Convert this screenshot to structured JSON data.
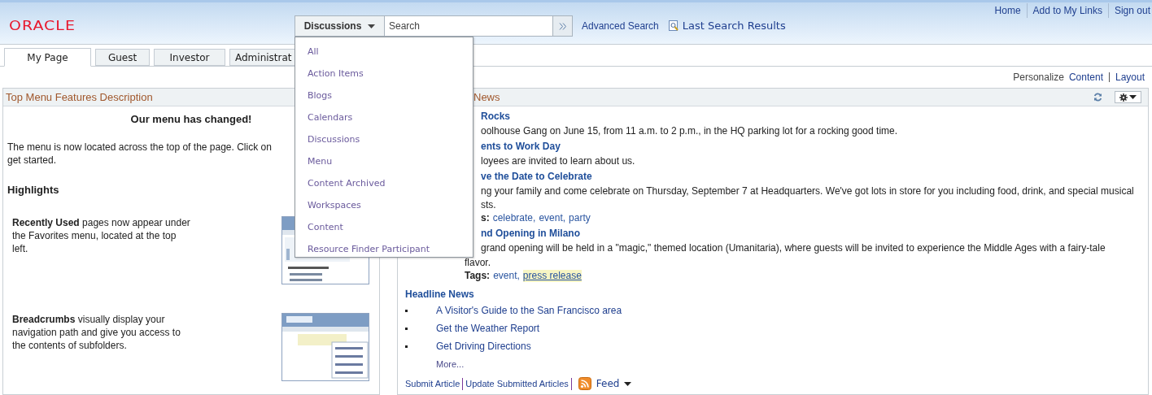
{
  "header": {
    "logo": "ORACLE",
    "top_links": [
      "Home",
      "Add to My Links",
      "Sign out"
    ],
    "search": {
      "scope": "Discussions",
      "placeholder": "Search"
    },
    "advanced_search": "Advanced Search",
    "last_results": "Last Search Results"
  },
  "tabs": [
    {
      "label": "My Page",
      "selected": true
    },
    {
      "label": "Guest",
      "selected": false
    },
    {
      "label": "Investor",
      "selected": false
    },
    {
      "label": "Administrat",
      "selected": false
    }
  ],
  "page_actions": {
    "label": "Personalize",
    "links": [
      "Content",
      "Layout"
    ]
  },
  "left_portlet": {
    "title": "Top Menu Features Description",
    "heading": "Our menu has changed!",
    "intro": [
      "The menu is now located across the top of the page. Click on",
      "get started."
    ],
    "section": "Highlights",
    "highlights": [
      {
        "text": "**Recently Used** pages now appear under the Favorites menu, located at the top left."
      },
      {
        "text": "**Breadcrumbs** visually display your navigation path and give you access to the contents of subfolders."
      }
    ]
  },
  "news_portlet": {
    "title": "News",
    "articles": [
      {
        "title": "Rocks",
        "lines": [
          {
            "kind": "partial",
            "text": "oolhouse Gang on June 15, from 11 a.m. to 2 p.m., in the HQ parking lot for a rocking good time."
          }
        ]
      },
      {
        "title": "ents to Work Day",
        "lines": [
          {
            "kind": "partial",
            "text": "loyees are invited to learn about us."
          }
        ]
      },
      {
        "title": "ve the Date to Celebrate",
        "lines": [
          {
            "kind": "partial",
            "text": "ng your family and come celebrate on Thursday, September 7 at Headquarters. We've got lots in store for you including food, drink, and special musical"
          },
          {
            "kind": "partial",
            "text": "sts."
          },
          {
            "kind": "partial_tags",
            "label": "s:",
            "separator": ",",
            "tags": [
              {
                "text": "celebrate",
                "highlighted": false
              },
              {
                "text": "event",
                "highlighted": false
              },
              {
                "text": "party",
                "highlighted": false
              }
            ]
          }
        ]
      },
      {
        "title": "nd Opening in Milano",
        "lines": [
          {
            "kind": "partial",
            "text": "grand opening will be held in a \"magic,\" themed location (Umanitaria), where guests will be invited to experience the Middle Ages with a fairy-tale"
          },
          {
            "kind": "full",
            "text": "flavor."
          },
          {
            "kind": "tags",
            "label": "Tags:",
            "separator": ",",
            "tags": [
              {
                "text": "event",
                "highlighted": false
              },
              {
                "text": "press release",
                "highlighted": true
              }
            ]
          }
        ]
      }
    ],
    "headline_title": "Headline News",
    "headlines": [
      "A Visitor's Guide to the San Francisco area",
      "Get the Weather Report",
      "Get Driving Directions"
    ],
    "more": "More...",
    "footer_links": [
      "Submit Article",
      "Update Submitted Articles"
    ],
    "feed": "Feed"
  },
  "scope_menu": {
    "items": [
      "All",
      "Action Items",
      "Blogs",
      "Calendars",
      "Discussions",
      "Menu",
      "Content Archived",
      "Workspaces",
      "Content",
      "Resource Finder Participant"
    ]
  }
}
